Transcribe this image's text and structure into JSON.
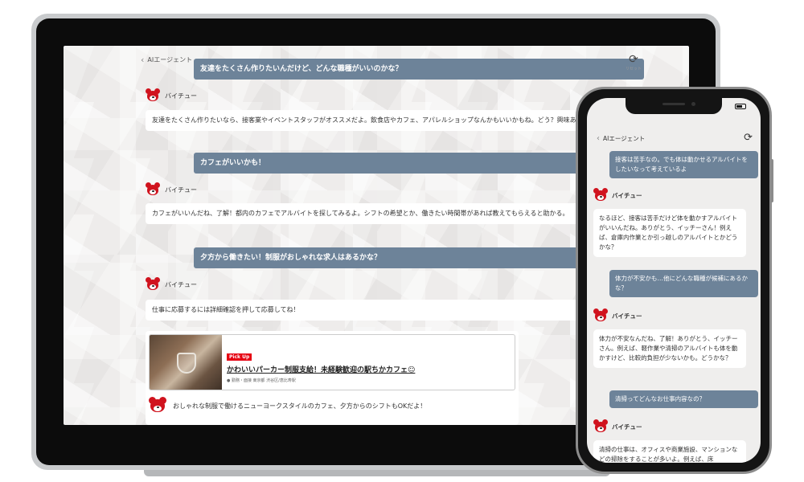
{
  "tablet": {
    "back_label": "AIエージェント",
    "reset_label": "リセット",
    "conversation": [
      {
        "role": "user",
        "text": "友達をたくさん作りたいんだけど、どんな職種がいいのかな？"
      },
      {
        "role": "bot",
        "name": "バイチュー",
        "text": "友達をたくさん作りたいなら、接客業やイベントスタッフがオススメだよ。飲食店やカフェ、アパレルショップなんかもいいかもね。どう？興味ある職種があれば教えてね。"
      },
      {
        "role": "user",
        "text": "カフェがいいかも！"
      },
      {
        "role": "bot",
        "name": "バイチュー",
        "text": "カフェがいいんだね、了解！都内のカフェでアルバイトを探してみるよ。シフトの希望とか、働きたい時間帯があれば教えてもらえると助かる。"
      },
      {
        "role": "user",
        "text": "夕方から働きたい！制服がおしゃれな求人はあるかな？"
      },
      {
        "role": "bot",
        "name": "バイチュー",
        "text": "仕事に応募するには詳細確認を押して応募してね！"
      }
    ],
    "job_card": {
      "badge": "Pick Up",
      "title": "かわいいパーカー制服支給！未経験歓迎の駅ちかカフェ☺",
      "location": "勤務・面接 東京都 渋谷区/恵比寿駅",
      "description": "おしゃれな制服で働けるニューヨークスタイルのカフェ、夕方からのシフトもOKだよ！"
    }
  },
  "phone": {
    "back_label": "AIエージェント",
    "conversation": [
      {
        "role": "user",
        "text": "接客は苦手なの。でも体は動かせるアルバイトをしたいなって考えているよ"
      },
      {
        "role": "bot",
        "name": "バイチュー",
        "text": "なるほど、接客は苦手だけど体を動かすアルバイトがいいんだね。ありがとう、イッチーさん！例えば、倉庫内作業とか引っ越しのアルバイトとかどうかな？"
      },
      {
        "role": "user",
        "text": "体力が不安かも…他にどんな職種が候補にあるかな？"
      },
      {
        "role": "bot",
        "name": "バイチュー",
        "text": "体力が不安なんだね、了解！ありがとう、イッチーさん。例えば、軽作業や清掃のアルバイトも体を動かすけど、比較的負担が少ないかも。どうかな？"
      },
      {
        "role": "user",
        "text": "清掃ってどんなお仕事内容なの？"
      },
      {
        "role": "bot",
        "name": "バイチュー",
        "text": "清掃の仕事は、オフィスや商業施設、マンションなどの掃除をすることが多いよ。例えば、床"
      }
    ]
  },
  "colors": {
    "user_bubble": "#6d8399",
    "brand_red": "#d0131e",
    "pickup_red": "#e60012"
  },
  "icons": {
    "back": "chevron-left-icon",
    "reset": "refresh-icon",
    "avatar": "bear-mascot-icon",
    "location": "map-pin-icon"
  }
}
